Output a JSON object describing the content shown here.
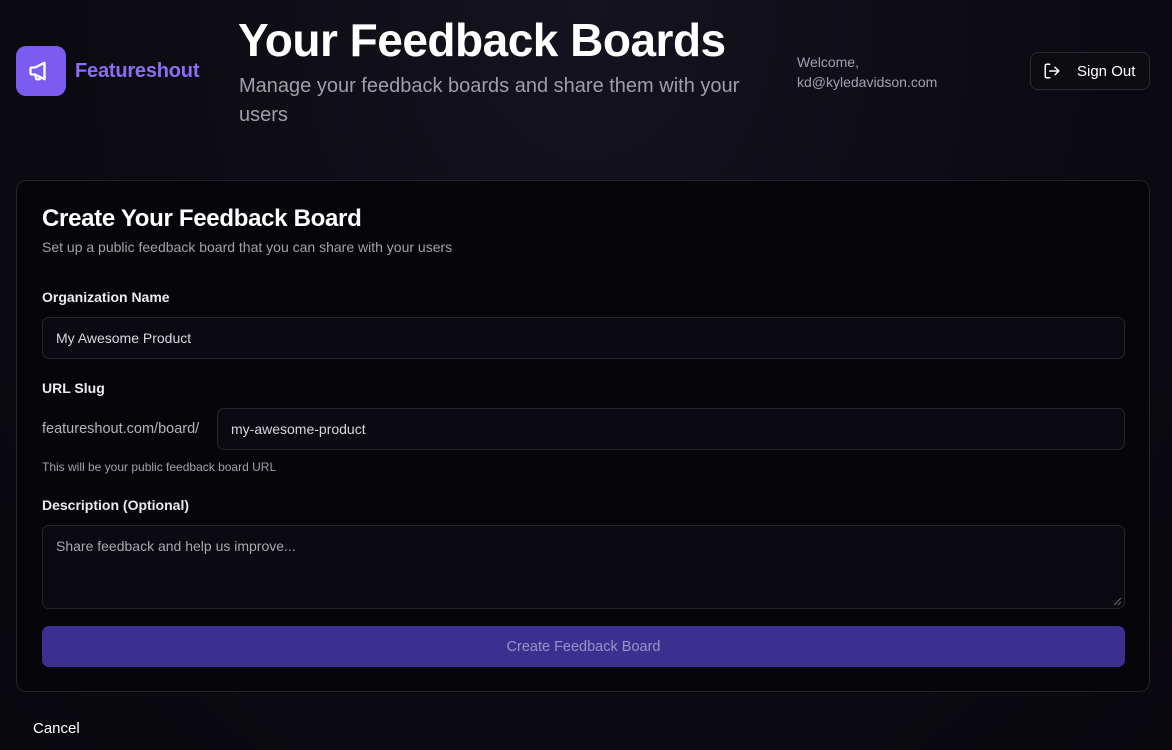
{
  "brand": {
    "name": "Featureshout",
    "logo_icon": "megaphone-icon",
    "accent_color": "#7c5cf0"
  },
  "header": {
    "title": "Your Feedback Boards",
    "subtitle": "Manage your feedback boards and share them with your users",
    "welcome_label": "Welcome,",
    "user_email": "kd@kyledavidson.com",
    "sign_out_label": "Sign Out",
    "sign_out_icon": "sign-out-icon"
  },
  "form": {
    "title": "Create Your Feedback Board",
    "subtitle": "Set up a public feedback board that you can share with your users",
    "org_name_label": "Organization Name",
    "org_name_value": "My Awesome Product",
    "slug_label": "URL Slug",
    "slug_prefix": "featureshout.com/board/",
    "slug_value": "my-awesome-product",
    "slug_hint": "This will be your public feedback board URL",
    "description_label": "Description (Optional)",
    "description_placeholder": "Share feedback and help us improve...",
    "submit_label": "Create Feedback Board",
    "submit_color": "#3b2f8f"
  },
  "cancel_label": "Cancel"
}
